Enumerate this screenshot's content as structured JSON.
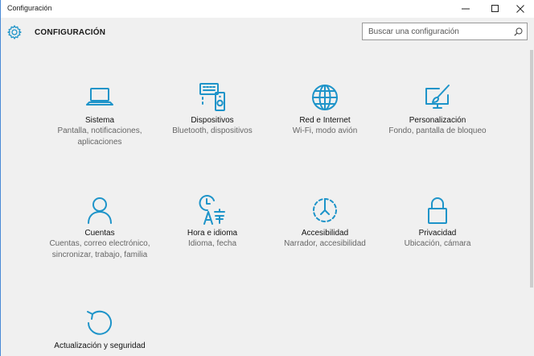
{
  "window": {
    "title": "Configuración"
  },
  "header": {
    "title": "CONFIGURACIÓN",
    "search_placeholder": "Buscar una configuración"
  },
  "icons": {
    "app": "gear-icon",
    "search": "search-icon"
  },
  "colors": {
    "accent": "#1e94c9",
    "background": "#f0f0f0"
  },
  "tiles": [
    {
      "title": "Sistema",
      "desc": "Pantalla, notificaciones, aplicaciones",
      "icon": "laptop-icon"
    },
    {
      "title": "Dispositivos",
      "desc": "Bluetooth, dispositivos",
      "icon": "devices-icon"
    },
    {
      "title": "Red e Internet",
      "desc": "Wi-Fi, modo avión",
      "icon": "globe-icon"
    },
    {
      "title": "Personalización",
      "desc": "Fondo, pantalla de bloqueo",
      "icon": "paint-icon"
    },
    {
      "title": "Cuentas",
      "desc": "Cuentas, correo electrónico, sincronizar, trabajo, familia",
      "icon": "person-icon"
    },
    {
      "title": "Hora e idioma",
      "desc": "Idioma, fecha",
      "icon": "time-language-icon"
    },
    {
      "title": "Accesibilidad",
      "desc": "Narrador, accesibilidad",
      "icon": "accessibility-icon"
    },
    {
      "title": "Privacidad",
      "desc": "Ubicación, cámara",
      "icon": "lock-icon"
    },
    {
      "title": "Actualización y seguridad",
      "desc": "",
      "icon": "update-icon"
    }
  ]
}
